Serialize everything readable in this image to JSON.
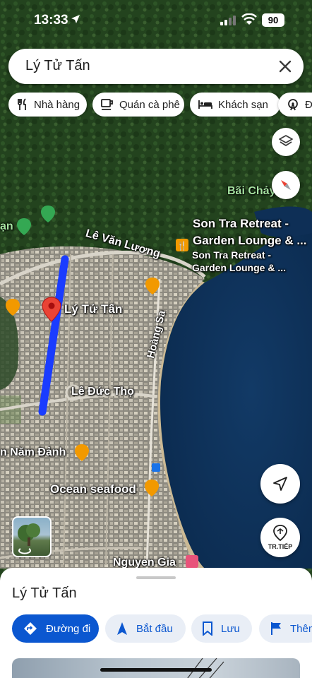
{
  "status_bar": {
    "time": "13:33",
    "battery": "90"
  },
  "search": {
    "query": "Lý Tử Tấn"
  },
  "chips": [
    {
      "label": "Nhà hàng",
      "icon": "restaurant-icon"
    },
    {
      "label": "Quán cà phê",
      "icon": "coffee-icon"
    },
    {
      "label": "Khách sạn",
      "icon": "hotel-icon"
    },
    {
      "label": "Đị",
      "icon": "attraction-icon"
    }
  ],
  "map_labels": {
    "bai_chay": "Bãi Chảy",
    "le_van_luong": "Lê Văn Lương",
    "son_tra_1": "Son Tra Retreat -",
    "son_tra_2": "Garden Lounge & ...",
    "son_tra_small_1": "Son Tra Retreat -",
    "son_tra_small_2": "Garden Lounge & ...",
    "ly_tu_tan": "Lý Tử Tấn",
    "hoang_sa": "Hoàng Sa",
    "le_duc_tho": "Lê Đức Thọ",
    "nam_danh": "n Năm Đảnh",
    "ocean_seafood": "Ocean seafood",
    "nguyen_gia": "Nguyen Gia",
    "partial_left": "ạn"
  },
  "nav_button": {
    "label": "TR.TIẾP"
  },
  "sheet": {
    "title": "Lý Tử Tấn",
    "actions": [
      {
        "label": "Đường đi",
        "icon": "directions-icon"
      },
      {
        "label": "Bắt đầu",
        "icon": "navigation-arrow-icon"
      },
      {
        "label": "Lưu",
        "icon": "bookmark-icon"
      },
      {
        "label": "Thêm",
        "icon": "flag-icon"
      }
    ]
  },
  "colors": {
    "accent": "#0b57d0",
    "route": "#1a3cff",
    "pin": "#ea4335",
    "chip_bg": "#ffffff",
    "secondary_btn": "#e9eef6"
  }
}
